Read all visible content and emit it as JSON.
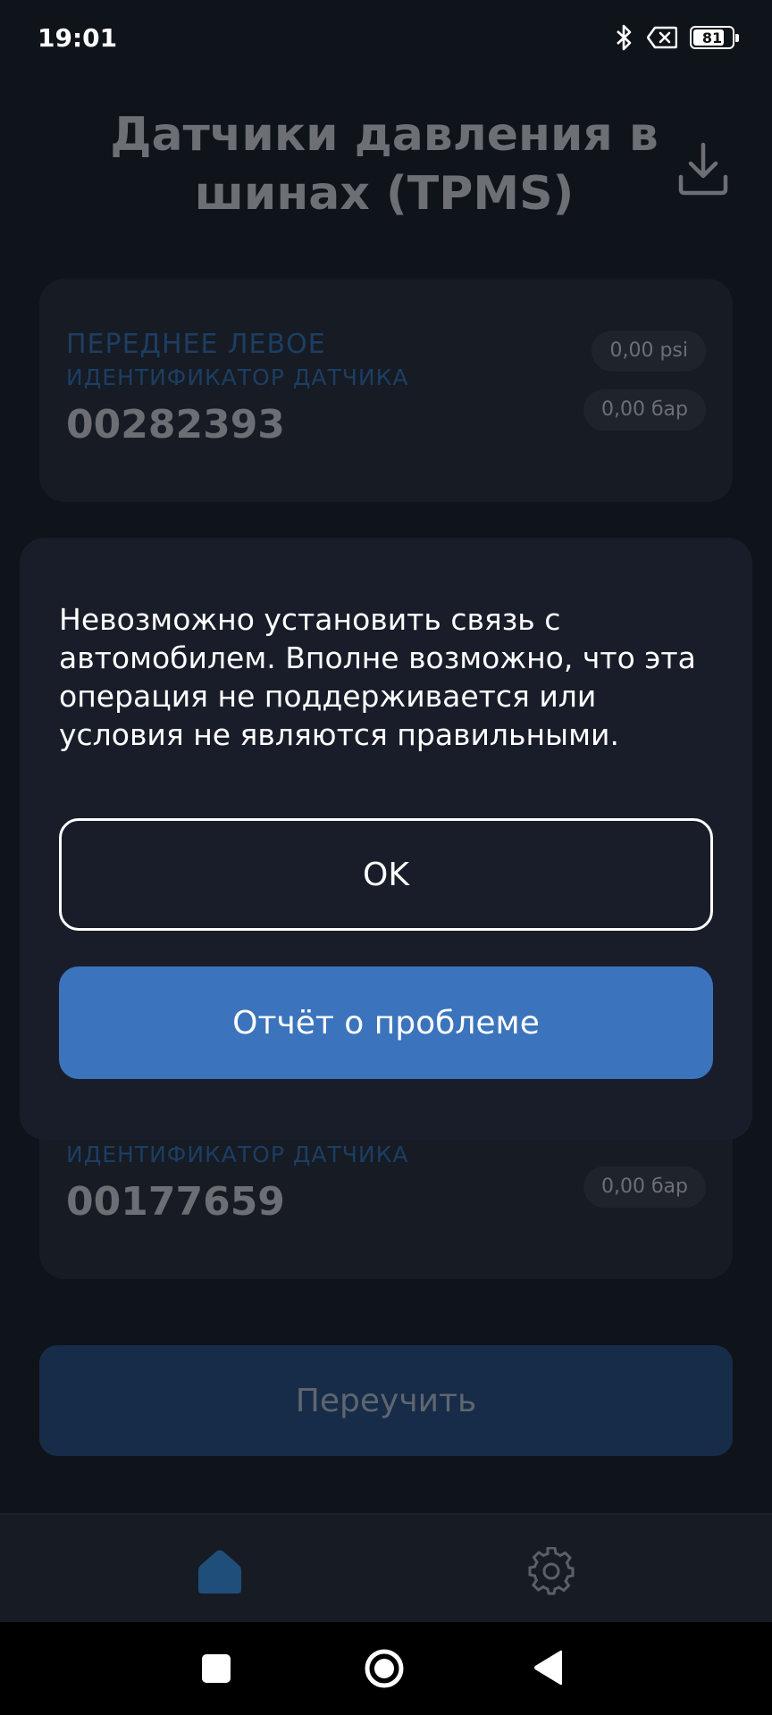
{
  "status_bar": {
    "time": "19:01",
    "battery_level": "81",
    "icons": [
      "bluetooth-icon",
      "no-data-icon",
      "battery-icon"
    ]
  },
  "header": {
    "title": "Датчики давления в шинах (TPMS)",
    "download_icon": "download-icon"
  },
  "sensors": [
    {
      "position": "ПЕРЕДНЕЕ ЛЕВОЕ",
      "id_label": "ИДЕНТИФИКАТОР ДАТЧИКА",
      "id": "00282393",
      "psi": "0,00 psi",
      "bar": "0,00 бар"
    },
    {
      "id_label": "ИДЕНТИФИКАТОР ДАТЧИКА",
      "id": "00177659",
      "bar": "0,00 бар"
    }
  ],
  "relearn_button": "Переучить",
  "dialog": {
    "message": "Невозможно установить связь с автомобилем. Вполне возможно, что эта операция не поддерживается или условия не являются правильными.",
    "ok_label": "OK",
    "report_label": "Отчёт о проблеме"
  },
  "bottom_nav": {
    "items": [
      "home-icon",
      "gear-icon"
    ]
  },
  "colors": {
    "background": "#0f131a",
    "card": "#161b24",
    "dialog": "#181d29",
    "accent": "#3b74bd",
    "label_blue": "#1d3e63"
  }
}
